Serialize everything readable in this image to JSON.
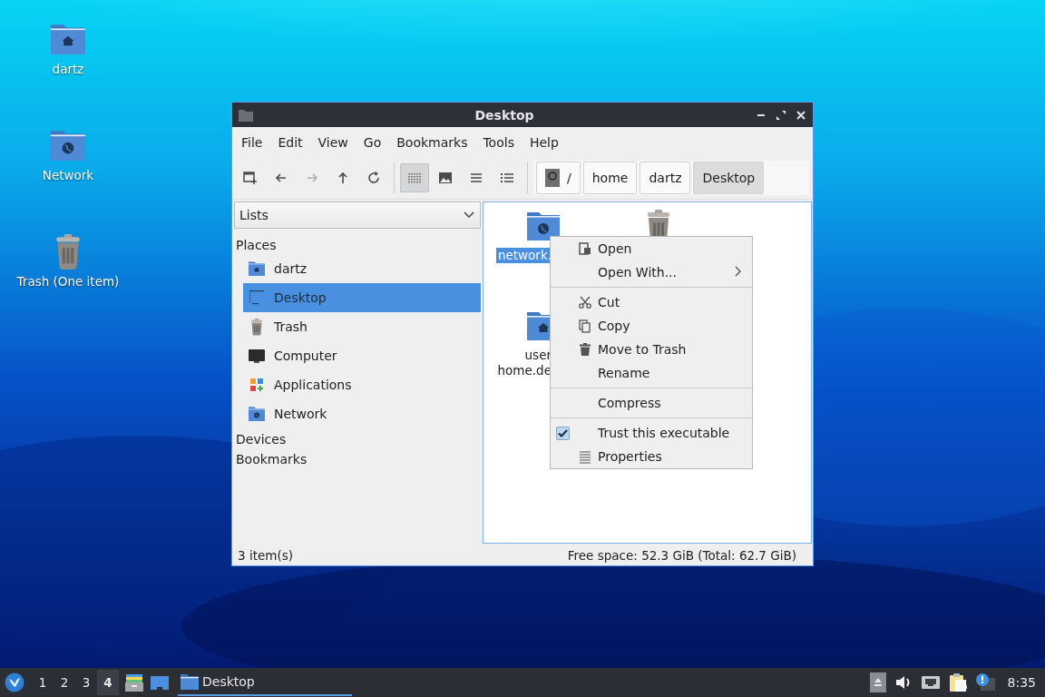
{
  "desktop_icons": [
    {
      "label": "dartz",
      "kind": "home-folder"
    },
    {
      "label": "Network",
      "kind": "network-folder"
    },
    {
      "label": "Trash (One item)",
      "kind": "trash"
    }
  ],
  "window": {
    "title": "Desktop",
    "menu": [
      "File",
      "Edit",
      "View",
      "Go",
      "Bookmarks",
      "Tools",
      "Help"
    ],
    "nav_buttons": [
      {
        "kind": "new-window",
        "disabled": false
      },
      {
        "kind": "back",
        "disabled": false
      },
      {
        "kind": "forward",
        "disabled": true
      },
      {
        "kind": "up",
        "disabled": false
      },
      {
        "kind": "reload",
        "disabled": false
      }
    ],
    "view_modes": [
      {
        "kind": "icons",
        "selected": true
      },
      {
        "kind": "thumbnails",
        "selected": false
      },
      {
        "kind": "compact",
        "selected": false
      },
      {
        "kind": "details",
        "selected": false
      }
    ],
    "path": [
      {
        "label": "/",
        "kind": "root",
        "selected": false
      },
      {
        "label": "home",
        "kind": "folder",
        "selected": false
      },
      {
        "label": "dartz",
        "kind": "folder",
        "selected": false
      },
      {
        "label": "Desktop",
        "kind": "folder",
        "selected": true
      }
    ],
    "sidebar": {
      "mode": "Lists",
      "sections": [
        {
          "title": "Places",
          "items": [
            {
              "label": "dartz",
              "kind": "home-folder",
              "selected": false
            },
            {
              "label": "Desktop",
              "kind": "desktop",
              "selected": true
            },
            {
              "label": "Trash",
              "kind": "trash",
              "selected": false
            },
            {
              "label": "Computer",
              "kind": "computer",
              "selected": false
            },
            {
              "label": "Applications",
              "kind": "applications",
              "selected": false
            },
            {
              "label": "Network",
              "kind": "network-folder",
              "selected": false
            }
          ]
        },
        {
          "title": "Devices"
        },
        {
          "title": "Bookmarks"
        }
      ]
    },
    "files": [
      {
        "label_lines": [
          "network."
        ],
        "kind": "network-folder",
        "selected": true
      },
      {
        "kind": "trash",
        "selected": false
      },
      {
        "label_lines": [
          "user",
          "home.de"
        ],
        "kind": "home-folder",
        "selected": false
      }
    ],
    "status_bar": {
      "item_count": "3 item(s)",
      "free_space": "Free space: 52.3 GiB (Total: 62.7 GiB)"
    }
  },
  "context_menu": {
    "sections": [
      [
        {
          "label": "Open",
          "kind": "open"
        },
        {
          "label": "Open With...",
          "kind": "submenu"
        }
      ],
      [
        {
          "label": "Cut",
          "kind": "cut"
        },
        {
          "label": "Copy",
          "kind": "copy"
        },
        {
          "label": "Move to Trash",
          "kind": "trash"
        },
        {
          "label": "Rename",
          "kind": "plain"
        }
      ],
      [
        {
          "label": "Compress",
          "kind": "plain"
        }
      ],
      [
        {
          "label": "Trust this executable",
          "kind": "check",
          "checked": true
        },
        {
          "label": "Properties",
          "kind": "properties"
        }
      ]
    ]
  },
  "taskbar": {
    "workspaces": [
      {
        "label": "1",
        "selected": false
      },
      {
        "label": "2",
        "selected": false
      },
      {
        "label": "3",
        "selected": false
      },
      {
        "label": "4",
        "selected": true
      }
    ],
    "launchers": [
      {
        "kind": "file-cabinet"
      },
      {
        "kind": "show-desktop"
      }
    ],
    "tasks": [
      {
        "label": "Desktop",
        "selected": true
      }
    ],
    "tray": [
      {
        "kind": "eject"
      },
      {
        "kind": "volume"
      },
      {
        "kind": "wired-network"
      },
      {
        "kind": "clipboard"
      },
      {
        "kind": "notification"
      }
    ],
    "clock": "8:35"
  }
}
